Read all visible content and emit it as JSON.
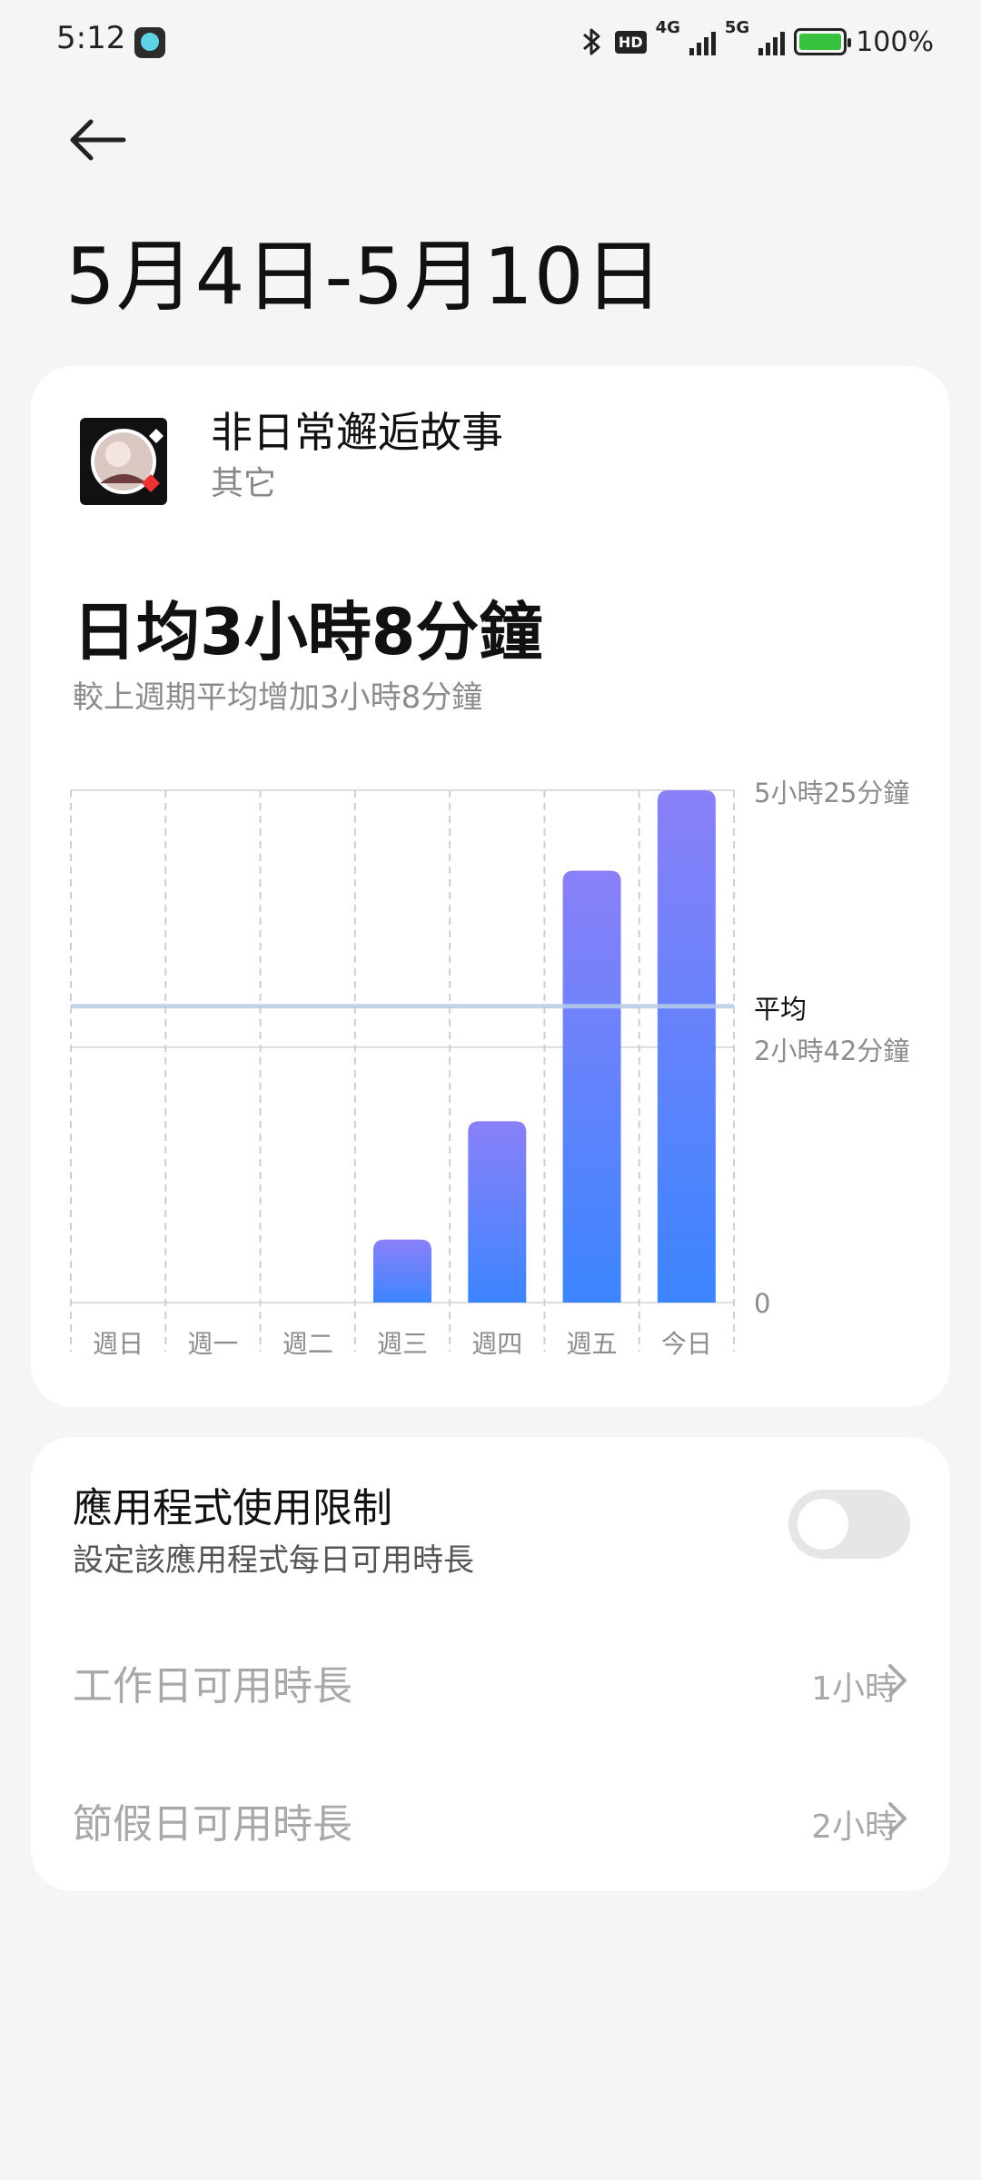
{
  "status_bar": {
    "time": "5:12",
    "hd_badge": "HD",
    "network_1": "4G",
    "network_2": "5G",
    "battery": "100%",
    "icons": [
      "bluetooth-icon",
      "hd-voice-icon",
      "signal-4g-icon",
      "signal-5g-icon",
      "battery-charging-icon"
    ]
  },
  "header": {
    "back_icon": "back-arrow-icon",
    "title": "5月4日-5月10日"
  },
  "app": {
    "name": "非日常邂逅故事",
    "category": "其它",
    "daily_average": "日均3小時8分鐘",
    "comparison": "較上週期平均增加3小時8分鐘"
  },
  "chart_data": {
    "type": "bar",
    "categories": [
      "週日",
      "週一",
      "週二",
      "週三",
      "週四",
      "週五",
      "今日"
    ],
    "values_minutes": [
      0,
      0,
      0,
      40,
      115,
      274,
      325
    ],
    "y_ticks": [
      "5小時25分鐘",
      "2小時42分鐘",
      "0"
    ],
    "y_max_minutes": 325,
    "average_label": "平均",
    "average_minutes": 188,
    "colors": {
      "bar_top": "#8a80f8",
      "bar_bottom": "#3c85ff",
      "average_line": "#b7cbe8",
      "grid": "#dddddd"
    }
  },
  "usage_limit": {
    "title": "應用程式使用限制",
    "subtitle": "設定該應用程式每日可用時長",
    "enabled": false,
    "rows": [
      {
        "label": "工作日可用時長",
        "value": "1小時"
      },
      {
        "label": "節假日可用時長",
        "value": "2小時"
      }
    ]
  }
}
